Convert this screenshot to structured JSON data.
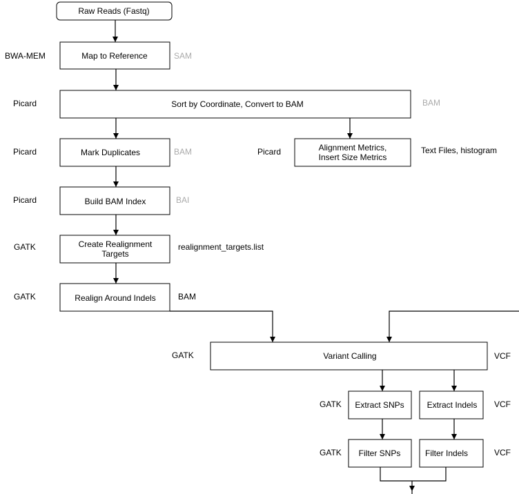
{
  "colors": {
    "stroke": "#000000",
    "format_label": "#aaaaaa",
    "background": "#ffffff"
  },
  "nodes": {
    "raw_reads": "Raw Reads (Fastq)",
    "map_ref": "Map to Reference",
    "sort": "Sort by Coordinate, Convert to BAM",
    "mark_dup": "Mark Duplicates",
    "align_metrics_1": "Alignment Metrics,",
    "align_metrics_2": "Insert Size Metrics",
    "build_index": "Build BAM Index",
    "create_targets_1": "Create Realignment",
    "create_targets_2": "Targets",
    "realign": "Realign Around Indels",
    "variant_calling": "Variant Calling",
    "extract_snps": "Extract SNPs",
    "extract_indels": "Extract Indels",
    "filter_snps": "Filter SNPs",
    "filter_indels": "Filter Indels"
  },
  "tools": {
    "map_ref": "BWA-MEM",
    "sort": "Picard",
    "mark_dup": "Picard",
    "align_metrics": "Picard",
    "build_index": "Picard",
    "create_targets": "GATK",
    "realign": "GATK",
    "variant_calling": "GATK",
    "extract": "GATK",
    "filter": "GATK"
  },
  "outputs": {
    "map_ref": "SAM",
    "sort": "BAM",
    "mark_dup": "BAM",
    "align_metrics": "Text Files, histogram",
    "build_index": "BAI",
    "create_targets": "realignment_targets.list",
    "realign": "BAM",
    "variant_calling": "VCF",
    "extract": "VCF",
    "filter": "VCF"
  }
}
